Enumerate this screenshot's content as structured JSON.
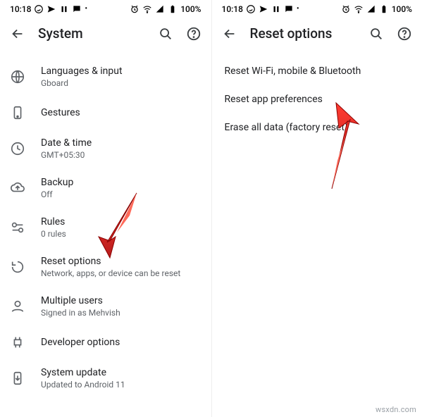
{
  "statusbar": {
    "time": "10:18",
    "battery": "100%"
  },
  "left": {
    "title": "System",
    "items": [
      {
        "label": "Languages & input",
        "sub": "Gboard"
      },
      {
        "label": "Gestures",
        "sub": ""
      },
      {
        "label": "Date & time",
        "sub": "GMT+05:30"
      },
      {
        "label": "Backup",
        "sub": "Off"
      },
      {
        "label": "Rules",
        "sub": "0 rules"
      },
      {
        "label": "Reset options",
        "sub": "Network, apps, or device can be reset"
      },
      {
        "label": "Multiple users",
        "sub": "Signed in as Mehvish"
      },
      {
        "label": "Developer options",
        "sub": ""
      },
      {
        "label": "System update",
        "sub": "Updated to Android 11"
      }
    ]
  },
  "right": {
    "title": "Reset options",
    "items": [
      {
        "label": "Reset Wi-Fi, mobile & Bluetooth"
      },
      {
        "label": "Reset app preferences"
      },
      {
        "label": "Erase all data (factory reset)"
      }
    ]
  },
  "watermark": "wsxdn.com"
}
